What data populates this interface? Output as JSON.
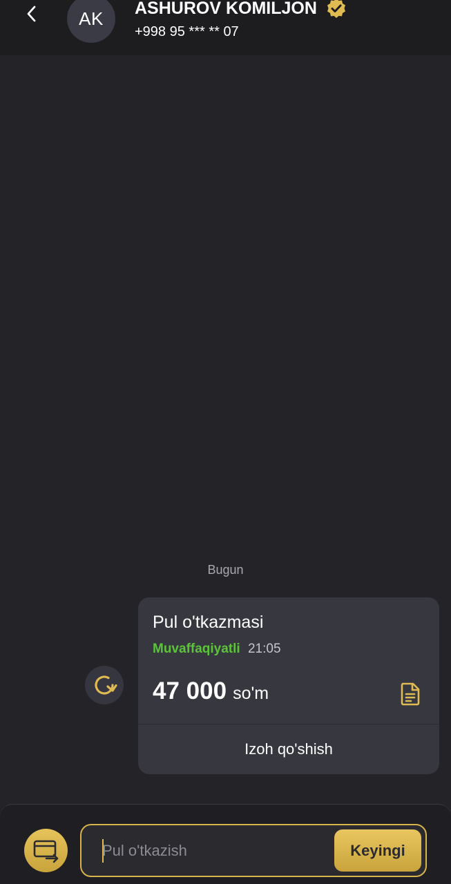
{
  "header": {
    "avatar_initials": "AK",
    "contact_name": "ASHUROV KOMILJON",
    "contact_phone": "+998 95 *** ** 07"
  },
  "chat": {
    "date_separator": "Bugun",
    "transfer_card": {
      "title": "Pul o'tkazmasi",
      "status": "Muvaffaqiyatli",
      "time": "21:05",
      "amount": "47 000",
      "currency": "so'm",
      "add_note_label": "Izoh qo'shish"
    }
  },
  "composer": {
    "placeholder": "Pul o'tkazish",
    "next_label": "Keyingi"
  },
  "colors": {
    "background": "#242428",
    "header_background": "#1d1d20",
    "card_background": "#36373f",
    "accent_gold": "#e0bb52",
    "status_success": "#5cc43a"
  },
  "icons": {
    "back": "chevron-left-icon",
    "verified": "verified-badge-icon",
    "repeat": "repeat-icon",
    "receipt": "receipt-icon",
    "transfer_mode": "card-transfer-icon"
  }
}
